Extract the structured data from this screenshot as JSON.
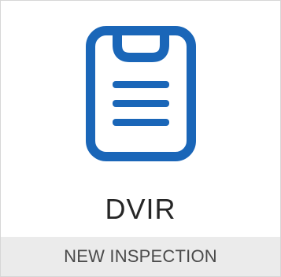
{
  "tile": {
    "icon": "clipboard-icon",
    "title": "DVIR",
    "action_label": "NEW INSPECTION"
  },
  "colors": {
    "icon_blue": "#1a66b8",
    "card_border": "#d6d6d6",
    "footer_bg": "#ebebeb",
    "title_text": "#262626",
    "footer_text": "#4a4a4a"
  }
}
